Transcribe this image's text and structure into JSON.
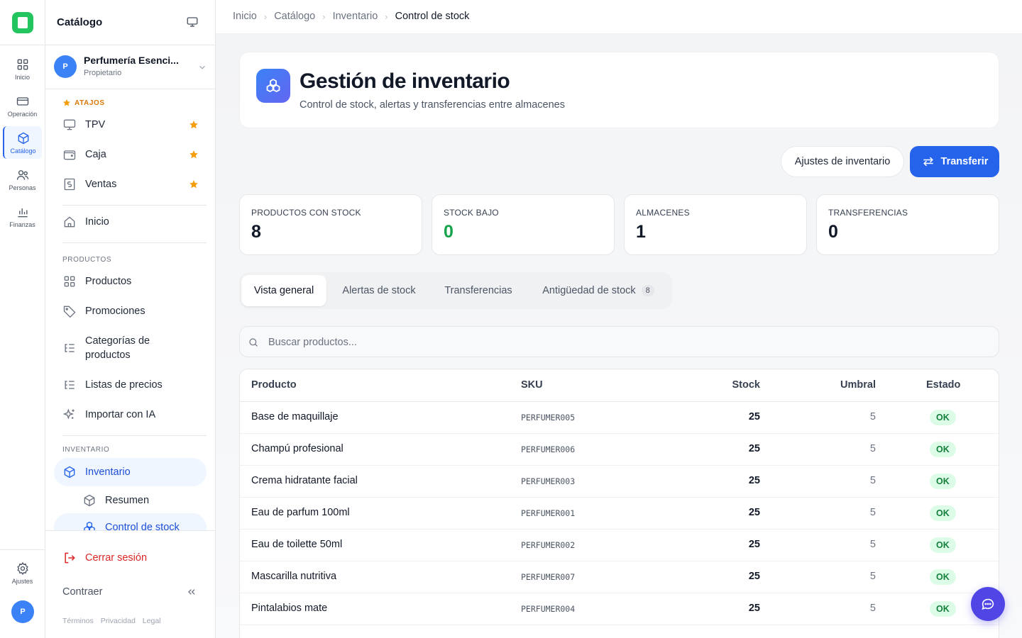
{
  "rail": {
    "items": [
      {
        "label": "Inicio",
        "icon": "grid-icon"
      },
      {
        "label": "Operación",
        "icon": "card-icon"
      },
      {
        "label": "Catálogo",
        "icon": "box-icon"
      },
      {
        "label": "Personas",
        "icon": "users-icon"
      },
      {
        "label": "Finanzas",
        "icon": "chart-icon"
      }
    ],
    "settings_label": "Ajustes",
    "avatar_initial": "P"
  },
  "sidebar": {
    "title": "Catálogo",
    "org": {
      "initial": "P",
      "name": "Perfumería Esenci...",
      "role": "Propietario"
    },
    "shortcuts_label": "ATAJOS",
    "shortcuts": [
      {
        "label": "TPV",
        "icon": "monitor-icon"
      },
      {
        "label": "Caja",
        "icon": "wallet-icon"
      },
      {
        "label": "Ventas",
        "icon": "receipt-icon"
      }
    ],
    "home_label": "Inicio",
    "products_section": "PRODUCTOS",
    "products_items": [
      {
        "label": "Productos",
        "icon": "grid-icon"
      },
      {
        "label": "Promociones",
        "icon": "tag-icon"
      },
      {
        "label": "Categorías de productos",
        "icon": "list-tree-icon"
      },
      {
        "label": "Listas de precios",
        "icon": "list-icon"
      },
      {
        "label": "Importar con IA",
        "icon": "sparkles-icon"
      }
    ],
    "inventory_section": "INVENTARIO",
    "inventory_label": "Inventario",
    "inventory_sub": [
      {
        "label": "Resumen",
        "icon": "box-icon"
      },
      {
        "label": "Control de stock",
        "icon": "boxes-icon"
      }
    ],
    "logout_label": "Cerrar sesión",
    "collapse_label": "Contraer",
    "legal": [
      "Términos",
      "Privacidad",
      "Legal"
    ]
  },
  "breadcrumb": [
    "Inicio",
    "Catálogo",
    "Inventario",
    "Control de stock"
  ],
  "header": {
    "title": "Gestión de inventario",
    "subtitle": "Control de stock, alertas y transferencias entre almacenes"
  },
  "actions": {
    "settings_label": "Ajustes de inventario",
    "transfer_label": "Transferir"
  },
  "stats": [
    {
      "label": "PRODUCTOS CON STOCK",
      "value": "8"
    },
    {
      "label": "STOCK BAJO",
      "value": "0"
    },
    {
      "label": "ALMACENES",
      "value": "1"
    },
    {
      "label": "TRANSFERENCIAS",
      "value": "0"
    }
  ],
  "tabs": [
    {
      "label": "Vista general"
    },
    {
      "label": "Alertas de stock"
    },
    {
      "label": "Transferencias"
    },
    {
      "label": "Antigüedad de stock",
      "badge": "8"
    }
  ],
  "search": {
    "placeholder": "Buscar productos..."
  },
  "table": {
    "headers": [
      "Producto",
      "SKU",
      "Stock",
      "Umbral",
      "Estado"
    ],
    "rows": [
      {
        "name": "Base de maquillaje",
        "sku": "PERFUMER005",
        "stock": "25",
        "threshold": "5",
        "status": "OK"
      },
      {
        "name": "Champú profesional",
        "sku": "PERFUMER006",
        "stock": "25",
        "threshold": "5",
        "status": "OK"
      },
      {
        "name": "Crema hidratante facial",
        "sku": "PERFUMER003",
        "stock": "25",
        "threshold": "5",
        "status": "OK"
      },
      {
        "name": "Eau de parfum 100ml",
        "sku": "PERFUMER001",
        "stock": "25",
        "threshold": "5",
        "status": "OK"
      },
      {
        "name": "Eau de toilette 50ml",
        "sku": "PERFUMER002",
        "stock": "25",
        "threshold": "5",
        "status": "OK"
      },
      {
        "name": "Mascarilla nutritiva",
        "sku": "PERFUMER007",
        "stock": "25",
        "threshold": "5",
        "status": "OK"
      },
      {
        "name": "Pintalabios mate",
        "sku": "PERFUMER004",
        "stock": "25",
        "threshold": "5",
        "status": "OK"
      }
    ]
  },
  "colors": {
    "accent": "#2563eb",
    "ok_bg": "#dcfce7",
    "ok_text": "#15803d",
    "low_stock": "#16a34a",
    "brand": "#22c55e"
  }
}
